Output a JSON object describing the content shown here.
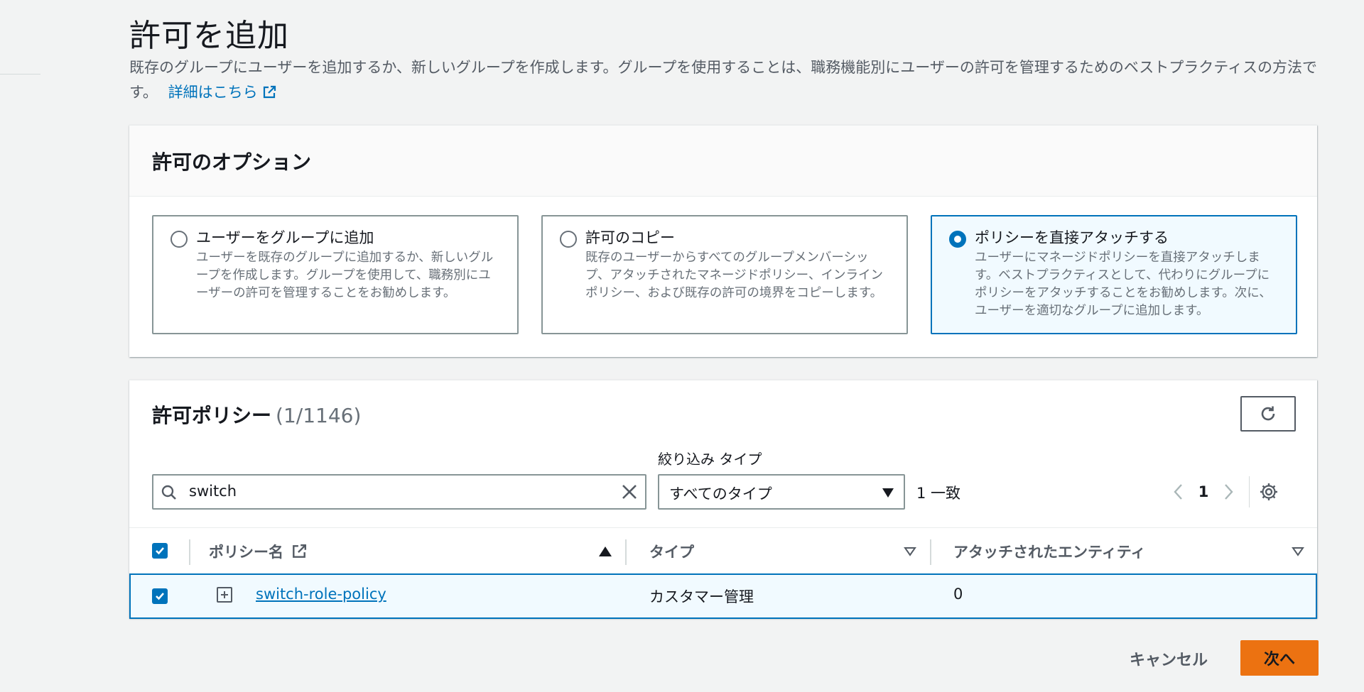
{
  "page": {
    "title": "許可を追加",
    "description": "既存のグループにユーザーを追加するか、新しいグループを作成します。グループを使用することは、職務機能別にユーザーの許可を管理するためのベストプラクティスの方法です。",
    "learn_more_link": "詳細はこちら"
  },
  "options_panel": {
    "header": "許可のオプション",
    "tiles": [
      {
        "title": "ユーザーをグループに追加",
        "description": "ユーザーを既存のグループに追加するか、新しいグループを作成します。グループを使用して、職務別にユーザーの許可を管理することをお勧めします。",
        "selected": false
      },
      {
        "title": "許可のコピー",
        "description": "既存のユーザーからすべてのグループメンバーシップ、アタッチされたマネージドポリシー、インラインポリシー、および既存の許可の境界をコピーします。",
        "selected": false
      },
      {
        "title": "ポリシーを直接アタッチする",
        "description": "ユーザーにマネージドポリシーを直接アタッチします。ベストプラクティスとして、代わりにグループにポリシーをアタッチすることをお勧めします。次に、ユーザーを適切なグループに追加します。",
        "selected": true
      }
    ]
  },
  "policies_panel": {
    "header": "許可ポリシー",
    "count": "(1/1146)",
    "filter_label": "絞り込み タイプ",
    "search_value": "switch",
    "type_select": "すべてのタイプ",
    "match_count": "1 一致",
    "current_page": "1",
    "columns": [
      "ポリシー名",
      "タイプ",
      "アタッチされたエンティティ"
    ],
    "rows": [
      {
        "name": "switch-role-policy",
        "type": "カスタマー管理",
        "entities": "0",
        "checked": true
      }
    ]
  },
  "footer": {
    "cancel": "キャンセル",
    "next": "次へ"
  },
  "colors": {
    "accent": "#0073bb",
    "primary_button": "#ec7211",
    "background": "#f2f3f3"
  },
  "icons": [
    "external-link-icon",
    "refresh-icon",
    "search-icon",
    "clear-icon",
    "chevron-left-icon",
    "chevron-right-icon",
    "gear-icon",
    "expand-icon",
    "sort-ascending-icon",
    "sort-icon"
  ]
}
